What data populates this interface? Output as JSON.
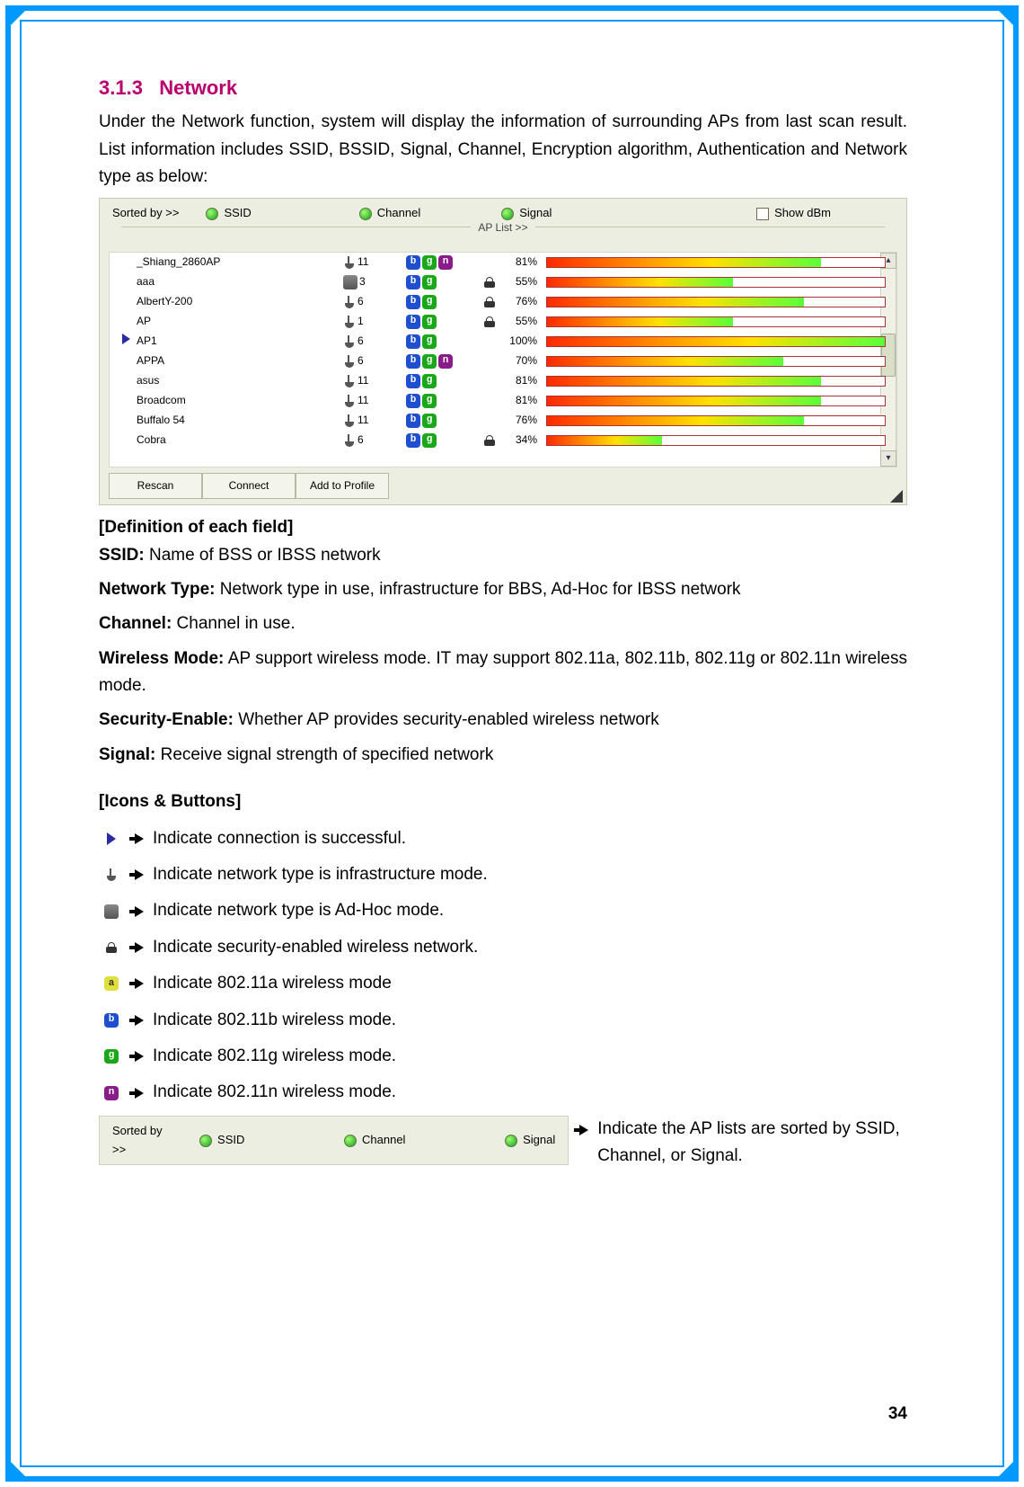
{
  "section": {
    "number": "3.1.3",
    "title": "Network",
    "intro": "Under the Network function, system will display the information of surrounding APs from last scan result. List information includes SSID, BSSID, Signal, Channel, Encryption algorithm, Authentication and Network type as below:"
  },
  "ap_panel": {
    "sorted_by": "Sorted by >>",
    "col_ssid": "SSID",
    "col_channel": "Channel",
    "col_signal": "Signal",
    "show_dbm": "Show dBm",
    "list_label": "AP List >>",
    "buttons": {
      "rescan": "Rescan",
      "connect": "Connect",
      "add": "Add to Profile"
    },
    "rows": [
      {
        "ssid": "_Shiang_2860AP",
        "type": "infra",
        "channel": 11,
        "modes": [
          "b",
          "g",
          "n"
        ],
        "locked": false,
        "signal": 81
      },
      {
        "ssid": "aaa",
        "type": "adhoc",
        "channel": 3,
        "modes": [
          "b",
          "g"
        ],
        "locked": true,
        "signal": 55
      },
      {
        "ssid": "AlbertY-200",
        "type": "infra",
        "channel": 6,
        "modes": [
          "b",
          "g"
        ],
        "locked": true,
        "signal": 76
      },
      {
        "ssid": "AP",
        "type": "infra",
        "channel": 1,
        "modes": [
          "b",
          "g"
        ],
        "locked": true,
        "signal": 55
      },
      {
        "ssid": "AP1",
        "type": "infra",
        "channel": 6,
        "modes": [
          "b",
          "g"
        ],
        "locked": false,
        "signal": 100,
        "connected": true
      },
      {
        "ssid": "APPA",
        "type": "infra",
        "channel": 6,
        "modes": [
          "b",
          "g",
          "n"
        ],
        "locked": false,
        "signal": 70
      },
      {
        "ssid": "asus",
        "type": "infra",
        "channel": 11,
        "modes": [
          "b",
          "g"
        ],
        "locked": false,
        "signal": 81
      },
      {
        "ssid": "Broadcom",
        "type": "infra",
        "channel": 11,
        "modes": [
          "b",
          "g"
        ],
        "locked": false,
        "signal": 81
      },
      {
        "ssid": "Buffalo 54",
        "type": "infra",
        "channel": 11,
        "modes": [
          "b",
          "g"
        ],
        "locked": false,
        "signal": 76
      },
      {
        "ssid": "Cobra",
        "type": "infra",
        "channel": 6,
        "modes": [
          "b",
          "g"
        ],
        "locked": true,
        "signal": 34
      }
    ]
  },
  "definitions": {
    "heading": "[Definition of each field]",
    "items": [
      {
        "label": "SSID:",
        "text": "Name of BSS or IBSS network"
      },
      {
        "label": "Network Type:",
        "text": "Network type in use, infrastructure for BBS, Ad-Hoc for IBSS network"
      },
      {
        "label": "Channel:",
        "text": "Channel in use."
      },
      {
        "label": "Wireless Mode:",
        "text": "AP support wireless mode. IT may support 802.11a, 802.11b, 802.11g or 802.11n wireless mode."
      },
      {
        "label": "Security-Enable:",
        "text": "Whether AP provides security-enabled wireless network"
      },
      {
        "label": "Signal:",
        "text": "Receive signal strength of specified network"
      }
    ]
  },
  "icons": {
    "heading": "[Icons & Buttons]",
    "items": [
      {
        "icon": "connected",
        "text": "Indicate connection is successful."
      },
      {
        "icon": "infra",
        "text": "Indicate network type is infrastructure mode."
      },
      {
        "icon": "adhoc",
        "text": "Indicate network type is Ad-Hoc mode."
      },
      {
        "icon": "lock",
        "text": "Indicate security-enabled wireless network."
      },
      {
        "icon": "a",
        "text": "Indicate 802.11a wireless mode"
      },
      {
        "icon": "b",
        "text": "Indicate 802.11b wireless mode."
      },
      {
        "icon": "g",
        "text": "Indicate 802.11g wireless mode."
      },
      {
        "icon": "n",
        "text": "Indicate 802.11n wireless mode."
      }
    ],
    "sort_strip_text": "Indicate the AP lists are sorted by SSID, Channel, or Signal."
  },
  "sort_strip": {
    "label": "Sorted by >>",
    "ssid": "SSID",
    "channel": "Channel",
    "signal": "Signal"
  },
  "page_number": "34"
}
